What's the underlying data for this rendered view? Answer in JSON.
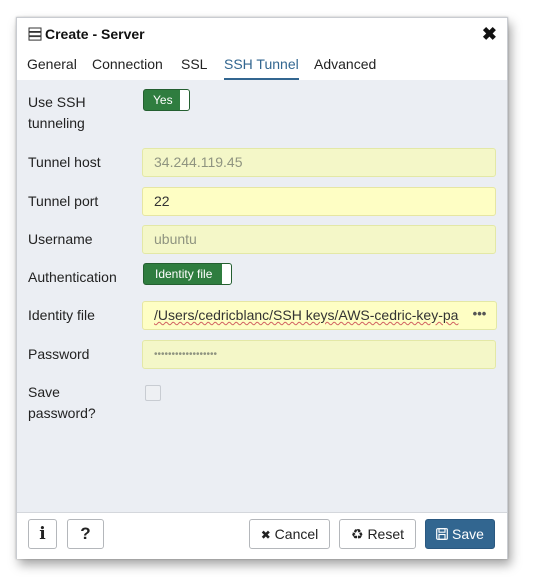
{
  "dialog": {
    "title": "Create - Server",
    "close_glyph": "✖"
  },
  "tabs": [
    {
      "label": "General"
    },
    {
      "label": "Connection"
    },
    {
      "label": "SSL"
    },
    {
      "label": "SSH Tunnel",
      "active": true
    },
    {
      "label": "Advanced"
    }
  ],
  "form": {
    "use_ssh": {
      "label_line1": "Use SSH",
      "label_line2": "tunneling",
      "toggle": "Yes"
    },
    "tunnel_host": {
      "label": "Tunnel host",
      "value": "34.244.119.45"
    },
    "tunnel_port": {
      "label": "Tunnel port",
      "value": "22"
    },
    "username": {
      "label": "Username",
      "value": "ubuntu"
    },
    "authentication": {
      "label": "Authentication",
      "toggle": "Identity file"
    },
    "identity_file": {
      "label": "Identity file",
      "value": "/Users/cedricblanc/SSH keys/AWS-cedric-key-pa",
      "button": "•••"
    },
    "password": {
      "label": "Password",
      "value": "••••••••••••••••••"
    },
    "save_password": {
      "label_line1": "Save",
      "label_line2": "password?",
      "checked": false
    }
  },
  "footer": {
    "info_glyph": "i",
    "help_glyph": "?",
    "cancel_label": "Cancel",
    "cancel_glyph": "✖",
    "reset_label": "Reset",
    "reset_glyph": "♻",
    "save_label": "Save"
  },
  "colors": {
    "accent": "#326690",
    "toggle_on": "#2f7d3f",
    "field_bg": "#f4f7c8",
    "dialog_bg": "#ebeef3"
  },
  "icons": [
    "server-icon",
    "close-icon",
    "info-icon",
    "help-icon",
    "cancel-icon",
    "reset-icon",
    "save-icon"
  ]
}
